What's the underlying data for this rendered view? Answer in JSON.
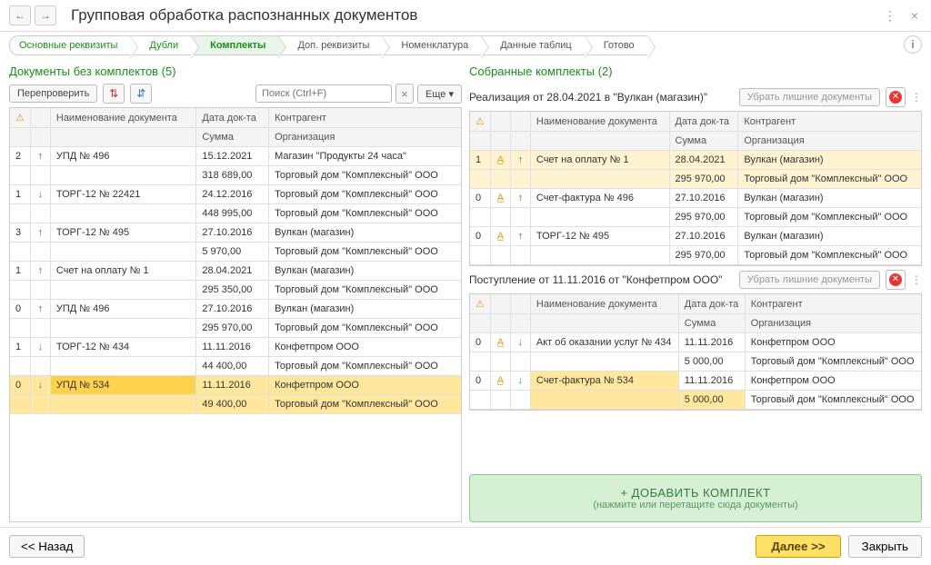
{
  "title": "Групповая обработка распознанных документов",
  "breadcrumb": [
    "Основные реквизиты",
    "Дубли",
    "Комплекты",
    "Доп. реквизиты",
    "Номенклатура",
    "Данные таблиц",
    "Готово"
  ],
  "left": {
    "heading": "Документы без комплектов (5)",
    "btn_recheck": "Перепроверить",
    "search_placeholder": "Поиск (Ctrl+F)",
    "btn_more": "Еще",
    "cols": {
      "name": "Наименование документа",
      "date": "Дата док-та",
      "cparty": "Контрагент",
      "sum": "Сумма",
      "org": "Организация"
    },
    "rows": [
      {
        "n": "2",
        "dir": "up",
        "name": "УПД № 496",
        "date": "15.12.2021",
        "cp": "Магазин \"Продукты 24 часа\"",
        "sum": "318 689,00",
        "org": "Торговый дом \"Комплексный\" ООО"
      },
      {
        "n": "1",
        "dir": "down",
        "name": "ТОРГ-12 № 22421",
        "date": "24.12.2016",
        "cp": "Торговый дом \"Комплексный\" ООО",
        "sum": "448 995,00",
        "org": "Торговый дом \"Комплексный\" ООО"
      },
      {
        "n": "3",
        "dir": "up",
        "name": "ТОРГ-12 № 495",
        "date": "27.10.2016",
        "cp": "Вулкан (магазин)",
        "sum": "5 970,00",
        "org": "Торговый дом \"Комплексный\" ООО"
      },
      {
        "n": "1",
        "dir": "up",
        "name": "Счет на оплату № 1",
        "date": "28.04.2021",
        "cp": "Вулкан (магазин)",
        "sum": "295 350,00",
        "org": "Торговый дом \"Комплексный\" ООО"
      },
      {
        "n": "0",
        "dir": "up",
        "name": "УПД № 496",
        "date": "27.10.2016",
        "cp": "Вулкан (магазин)",
        "sum": "295 970,00",
        "org": "Торговый дом \"Комплексный\" ООО"
      },
      {
        "n": "1",
        "dir": "down",
        "name": "ТОРГ-12 № 434",
        "date": "11.11.2016",
        "cp": "Конфетпром ООО",
        "sum": "44 400,00",
        "org": "Торговый дом \"Комплексный\" ООО"
      },
      {
        "n": "0",
        "dir": "down",
        "name": "УПД № 534",
        "date": "11.11.2016",
        "cp": "Конфетпром ООО",
        "sum": "49 400,00",
        "org": "Торговый дом \"Комплексный\" ООО",
        "selected": true
      }
    ]
  },
  "right": {
    "heading": "Собранные комплекты (2)",
    "remove_label": "Убрать лишние документы",
    "cols": {
      "name": "Наименование документа",
      "date": "Дата док-та",
      "cparty": "Контрагент",
      "sum": "Сумма",
      "org": "Организация"
    },
    "sets": [
      {
        "title": "Реализация от 28.04.2021 в \"Вулкан (магазин)\"",
        "rows": [
          {
            "n": "1",
            "warn": true,
            "dir": "up",
            "name": "Счет на оплату № 1",
            "date": "28.04.2021",
            "cp": "Вулкан (магазин)",
            "sum": "295 970,00",
            "org": "Торговый дом \"Комплексный\" ООО",
            "hl": true
          },
          {
            "n": "0",
            "warn": true,
            "dir": "up",
            "name": "Счет-фактура № 496",
            "date": "27.10.2016",
            "cp": "Вулкан (магазин)",
            "sum": "295 970,00",
            "org": "Торговый дом \"Комплексный\" ООО"
          },
          {
            "n": "0",
            "warn": true,
            "dir": "up",
            "name": "ТОРГ-12 № 495",
            "date": "27.10.2016",
            "cp": "Вулкан (магазин)",
            "sum": "295 970,00",
            "org": "Торговый дом \"Комплексный\" ООО"
          }
        ]
      },
      {
        "title": "Поступление от 11.11.2016 от \"Конфетпром ООО\"",
        "rows": [
          {
            "n": "0",
            "warn": true,
            "dir": "down",
            "name": "Акт об оказании услуг № 434",
            "date": "11.11.2016",
            "cp": "Конфетпром ООО",
            "sum": "5 000,00",
            "org": "Торговый дом \"Комплексный\" ООО"
          },
          {
            "n": "0",
            "warn": true,
            "dir": "down",
            "name": "Счет-фактура № 534",
            "date": "11.11.2016",
            "cp": "Конфетпром ООО",
            "sum": "5 000,00",
            "org": "Торговый дом \"Комплексный\" ООО",
            "hl2": true
          }
        ]
      }
    ],
    "add_main": "+ ДОБАВИТЬ КОМПЛЕКТ",
    "add_sub": "(нажмите или перетащите сюда документы)"
  },
  "footer": {
    "back": "<< Назад",
    "next": "Далее >>",
    "close": "Закрыть"
  }
}
